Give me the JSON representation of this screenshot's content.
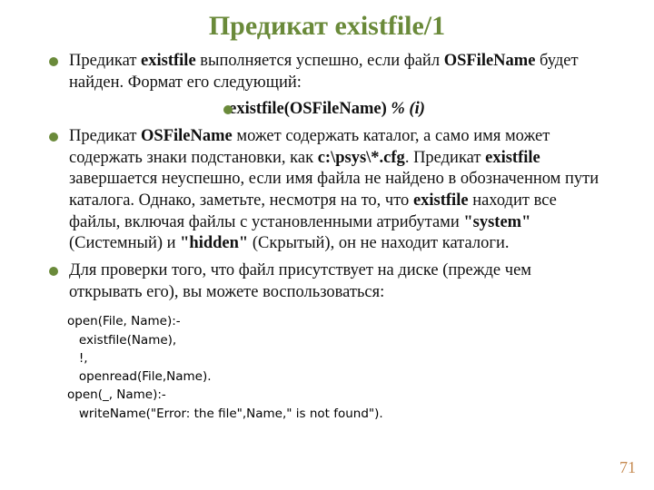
{
  "title": "Предикат  existfile/1",
  "bullets": {
    "b1_pre": "Предикат ",
    "b1_kw1": "existfile",
    "b1_mid1": " выполняется успешно, если файл ",
    "b1_kw2": "OSFileName",
    "b1_mid2": " будет найден. Формат его следующий:",
    "b2_kw": "existfile(OSFileName) ",
    "b2_flow": "% (i)",
    "b3_pre": "   Предикат ",
    "b3_kw1": "OSFileName",
    "b3_mid1": " может содержать каталог, а само имя может содержать знаки подстановки, как ",
    "b3_kw2": "c:\\psys\\*.cfg",
    "b3_mid2": ". Предикат ",
    "b3_kw3": "existfile",
    "b3_mid3": " завершается неуспешно, если имя файла не найдено в обозначенном пути каталога. Однако, заметьте, несмотря на то, что ",
    "b3_kw4": "existfile",
    "b3_mid4": " находит все файлы, включая файлы с установленными атрибутами ",
    "b3_kw5": "\"system\"",
    "b3_mid5": " (Системный) и ",
    "b3_kw6": "\"hidden\"",
    "b3_mid6": " (Скрытый), он не находит каталоги.",
    "b4": "   Для проверки того, что файл присутствует на диске (прежде чем открывать его), вы можете воспользоваться:"
  },
  "code": "open(File, Name):-\n   existfile(Name),\n   !,\n   openread(File,Name).\nopen(_, Name):-\n   writeName(\"Error: the file\",Name,\" is not found\").",
  "pagenum": "71"
}
